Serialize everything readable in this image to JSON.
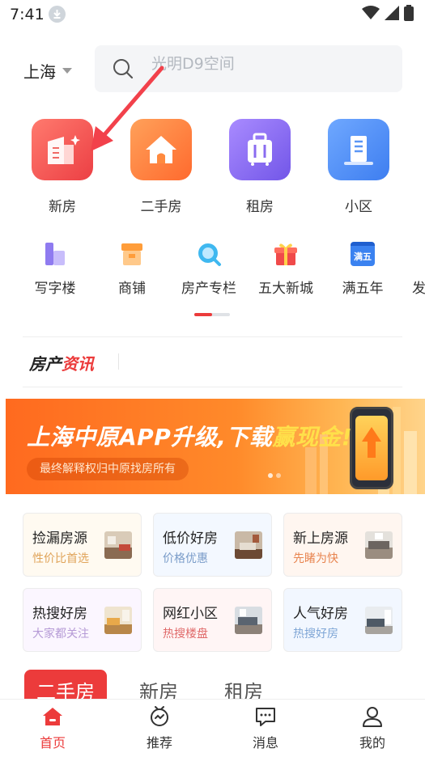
{
  "status_bar": {
    "time": "7:41"
  },
  "header": {
    "city": "上海",
    "search_placeholder": "光明D9空间"
  },
  "main_categories": [
    {
      "label": "新房",
      "icon": "building-icon",
      "color": "#f0524f"
    },
    {
      "label": "二手房",
      "icon": "house-icon",
      "color": "#ff7a3a"
    },
    {
      "label": "租房",
      "icon": "suitcase-icon",
      "color": "#8a6cf0"
    },
    {
      "label": "小区",
      "icon": "community-icon",
      "color": "#4f8ef7"
    }
  ],
  "sub_categories": [
    {
      "label": "写字楼",
      "icon": "office-icon"
    },
    {
      "label": "商铺",
      "icon": "shop-icon"
    },
    {
      "label": "房产专栏",
      "icon": "column-icon"
    },
    {
      "label": "五大新城",
      "icon": "gift-icon"
    },
    {
      "label": "满五年",
      "icon": "calendar-icon",
      "badge": "满五"
    },
    {
      "label": "发",
      "icon": "partial-icon"
    }
  ],
  "news": {
    "title_a": "房产",
    "title_b": "资讯"
  },
  "banner": {
    "headline_a": "上海中原APP升级,下载",
    "headline_b": "赢现金!",
    "sub": "最终解释权归中原找房所有"
  },
  "cards": [
    {
      "title": "捡漏房源",
      "sub": "性价比首选",
      "sub_color": "#e0a45a",
      "bg": "#fffaf1"
    },
    {
      "title": "低价好房",
      "sub": "价格优惠",
      "sub_color": "#7a9cc9",
      "bg": "#f3f8ff"
    },
    {
      "title": "新上房源",
      "sub": "先睹为快",
      "sub_color": "#e8844f",
      "bg": "#fff6f0"
    },
    {
      "title": "热搜好房",
      "sub": "大家都关注",
      "sub_color": "#b59ad6",
      "bg": "#fbf6ff"
    },
    {
      "title": "网红小区",
      "sub": "热搜楼盘",
      "sub_color": "#e06a6a",
      "bg": "#fff5f5"
    },
    {
      "title": "人气好房",
      "sub": "热搜好房",
      "sub_color": "#7fa6d6",
      "bg": "#f2f7ff"
    }
  ],
  "tabs": [
    "二手房",
    "新房",
    "租房"
  ],
  "bottom_nav": [
    {
      "label": "首页",
      "icon": "home-icon",
      "active": true
    },
    {
      "label": "推荐",
      "icon": "recommend-icon",
      "active": false
    },
    {
      "label": "消息",
      "icon": "message-icon",
      "active": false
    },
    {
      "label": "我的",
      "icon": "profile-icon",
      "active": false
    }
  ],
  "colors": {
    "accent": "#ec3b3b",
    "annotation_arrow": "#f2414b"
  }
}
